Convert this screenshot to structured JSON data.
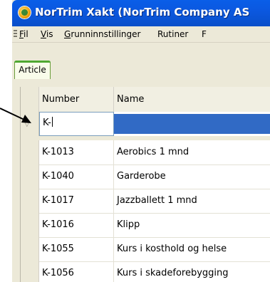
{
  "window": {
    "title": "NorTrim Xakt (NorTrim Company AS"
  },
  "menu": {
    "items": [
      {
        "label": "Fil",
        "accel": "F"
      },
      {
        "label": "Vis",
        "accel": "V"
      },
      {
        "label": "Grunninnstillinger",
        "accel": "G"
      },
      {
        "label": "Rutiner",
        "accel": ""
      },
      {
        "label": "F",
        "accel": ""
      }
    ]
  },
  "tabs": [
    {
      "label": "Article",
      "active": true
    }
  ],
  "grid": {
    "columns": [
      {
        "label": "Number"
      },
      {
        "label": "Name"
      }
    ],
    "filter": {
      "number_value": "K-",
      "name_value": ""
    },
    "rows": [
      {
        "number": "K-1013",
        "name": "Aerobics 1 mnd"
      },
      {
        "number": "K-1040",
        "name": "Garderobe"
      },
      {
        "number": "K-1017",
        "name": "Jazzballett 1 mnd"
      },
      {
        "number": "K-1016",
        "name": "Klipp"
      },
      {
        "number": "K-1055",
        "name": "Kurs i kosthold og helse"
      },
      {
        "number": "K-1056",
        "name": "Kurs i skadeforebygging"
      }
    ]
  },
  "colors": {
    "titlebar": "#0a5ee8",
    "selection": "#316ac5",
    "tab_accent": "#4fa832"
  }
}
